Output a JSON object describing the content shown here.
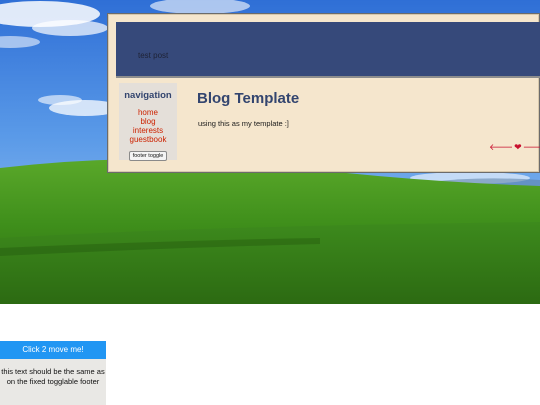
{
  "wallpaper": {
    "scene": "bliss-wallpaper"
  },
  "blog": {
    "header_text": "test post",
    "nav_title": "navigation",
    "nav_links": [
      "home",
      "blog",
      "interests",
      "guestbook"
    ],
    "footer_toggle_label": "footer toggle",
    "post_title": "Blog Template",
    "post_body": "using this as my template :]",
    "webring": {
      "prev_icon": "arrow-left-icon",
      "prev_glyph": "🡐",
      "center_icon": "heart-icon",
      "center_glyph": "❤",
      "next_icon": "arrow-right-icon",
      "next_glyph": "🡒"
    }
  },
  "drag_box": {
    "header_label": "Click 2 move me!",
    "body_text": "this text should be the same as on the fixed togglable footer"
  },
  "colors": {
    "header_bg": "#36497a",
    "page_bg": "#f5e6cd",
    "accent_link": "#cc2200",
    "drag_header": "#2196f3"
  }
}
